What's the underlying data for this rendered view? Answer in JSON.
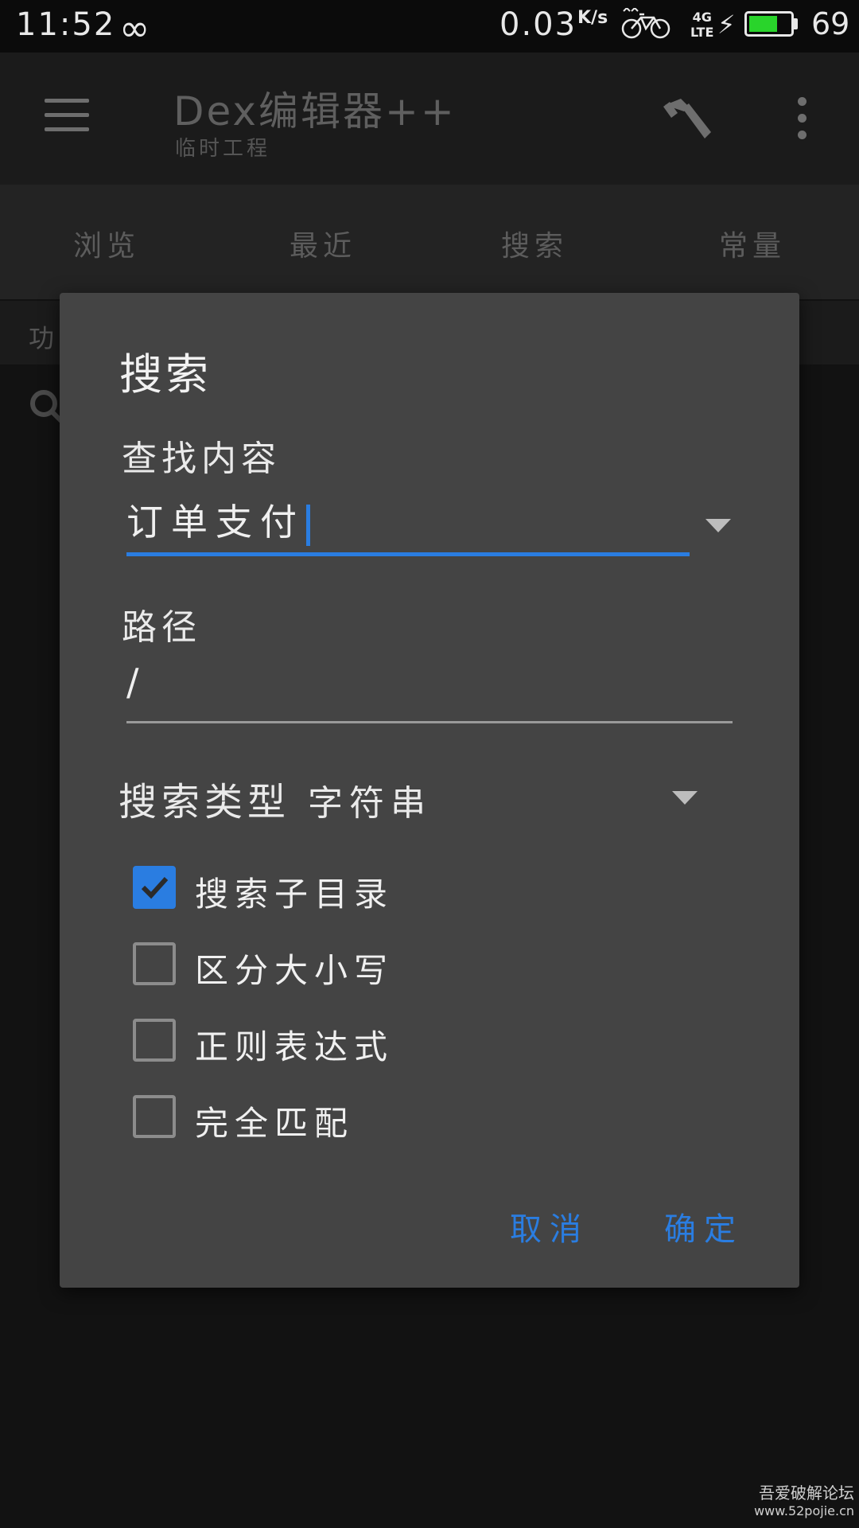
{
  "status_bar": {
    "time": "11:52",
    "loop_icon": "∞",
    "speed_value": "0.03",
    "speed_unit": "K/s",
    "network": "4G",
    "network_sub": "LTE",
    "battery_level": "69",
    "battery_fill_percent": 69,
    "battery_color": "#29d42b"
  },
  "toolbar": {
    "title": "Dex编辑器++",
    "subtitle": "临时工程"
  },
  "tabs": [
    "浏览",
    "最近",
    "搜索",
    "常量"
  ],
  "subbar": {
    "text": "功"
  },
  "dialog": {
    "title": "搜索",
    "find_label": "查找内容",
    "find_value": "订单支付",
    "path_label": "路径",
    "path_value": "/",
    "type_label": "搜索类型",
    "type_value": "字符串",
    "options": [
      {
        "label": "搜索子目录",
        "checked": true
      },
      {
        "label": "区分大小写",
        "checked": false
      },
      {
        "label": "正则表达式",
        "checked": false
      },
      {
        "label": "完全匹配",
        "checked": false
      }
    ],
    "cancel_label": "取消",
    "ok_label": "确定"
  },
  "watermark": {
    "line1": "吾爱破解论坛",
    "line2": "www.52pojie.cn"
  },
  "colors": {
    "accent": "#2a7de1",
    "dialog_bg": "#444444"
  }
}
